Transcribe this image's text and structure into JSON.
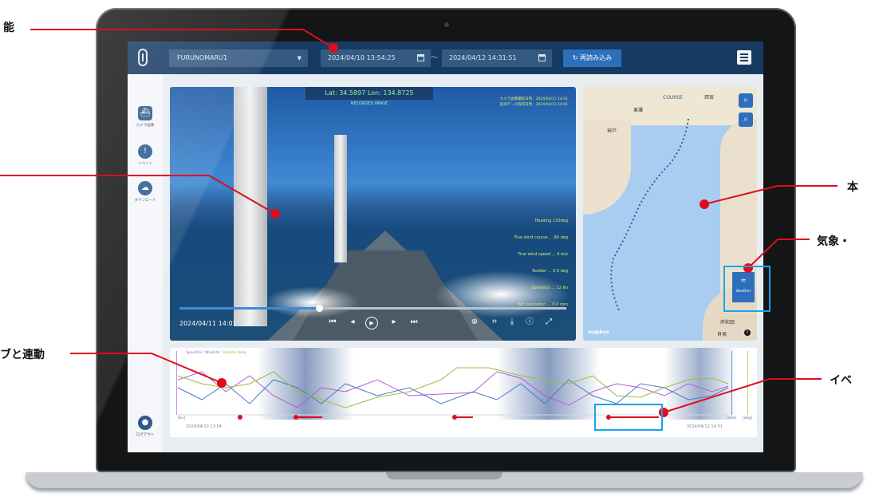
{
  "app": {
    "ship_selector": "FURUNOMARU1",
    "date_from": "2024/04/10 13:54:25",
    "date_to": "2024/04/12 14:31:51",
    "range_separator": "〜",
    "reload_button": "再読み込み"
  },
  "sidebar": {
    "items": [
      {
        "label": "カメラ画像",
        "icon": "ship-icon"
      },
      {
        "label": "イベント",
        "icon": "alert-icon"
      },
      {
        "label": "ダウンロード",
        "icon": "cloud-download-icon"
      }
    ],
    "logout": {
      "label": "ログアウト",
      "icon": "user-icon"
    }
  },
  "video": {
    "latlon": "Lat: 34.5897   Lon: 134.8725",
    "recorded": "RECORDED IMAGE",
    "overlay_top": [
      "カメラ画像撮影日時：2024/04/11 14:01",
      "航海データ取得日時：2024/04/11 14:01"
    ],
    "overlay_values": [
      "Heading 110deg",
      "True wind course ... 80 deg",
      "True wind speed ... 4 m/s",
      "Rudder ... 0.3 deg",
      "Speed(G) ... 12 Kn",
      "M/E revolution ... 0.0 rpm"
    ],
    "timestamp": "2024/04/11 14:01",
    "progress_fraction": 0.36,
    "controls": [
      "skip-back-icon",
      "step-back-icon",
      "play-icon",
      "step-forward-icon",
      "skip-forward-icon"
    ],
    "tools": [
      "zoom-in-icon",
      "crop-icon",
      "download-icon",
      "info-icon",
      "fullscreen-icon"
    ]
  },
  "map": {
    "course_label": "COURSE",
    "cities": [
      "西宮",
      "東灘",
      "神戸",
      "岸和田",
      "貝塚"
    ],
    "weather_button": "Weather",
    "attribution": "mapbox"
  },
  "timeline": {
    "legend": [
      "Speed(G)",
      "Wind dir",
      "Outside temp"
    ],
    "date_start": "2024/04/10 13:54",
    "date_end": "2024/04/12 14:31",
    "axis_left_unit": "[kn]",
    "axis_right_units": [
      "[m/s]",
      "[deg]"
    ]
  },
  "callouts": {
    "top_left": "能",
    "bottom_left": "ブと連動",
    "right_map": "本",
    "right_weather": "気象・",
    "right_event": "イベ"
  },
  "colors": {
    "accent": "#2d6fbd",
    "topbar": "#173a63",
    "callout_red": "#e00b1c",
    "highlight_blue": "#1aa3e8"
  }
}
